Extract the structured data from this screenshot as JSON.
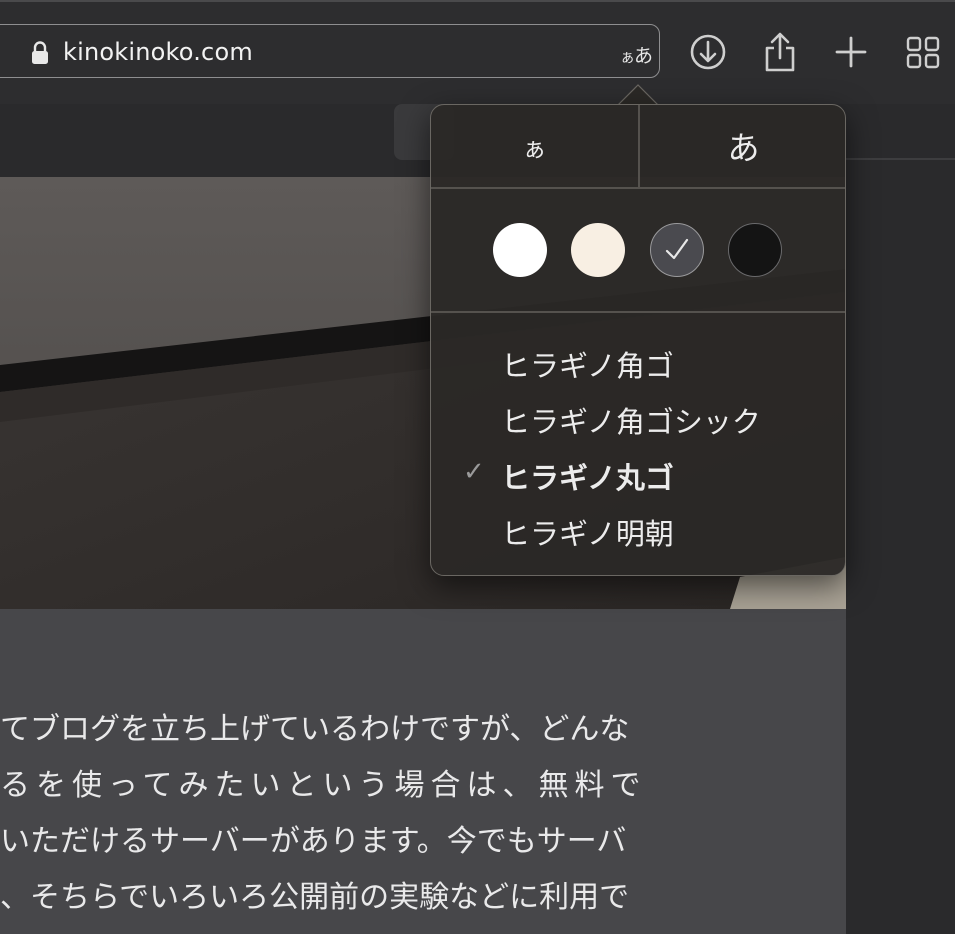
{
  "toolbar": {
    "url": "kinokinoko.com",
    "text_size_button": {
      "small": "ぁ",
      "large": "あ"
    }
  },
  "popover": {
    "size_small_label": "ぁ",
    "size_large_label": "あ",
    "themes": [
      {
        "name": "white",
        "color": "#ffffff",
        "selected": false
      },
      {
        "name": "sepia",
        "color": "#f8efe3",
        "selected": false
      },
      {
        "name": "gray",
        "color": "#4a4a4f",
        "selected": true
      },
      {
        "name": "black",
        "color": "#141414",
        "selected": false
      }
    ],
    "fonts": [
      {
        "label": "ヒラギノ角ゴ",
        "selected": false
      },
      {
        "label": "ヒラギノ角ゴシック",
        "selected": false
      },
      {
        "label": "ヒラギノ丸ゴ",
        "selected": true
      },
      {
        "label": "ヒラギノ明朝",
        "selected": false
      }
    ],
    "checkmark": "✓"
  },
  "article": {
    "lines": [
      "てブログを立ち上げているわけですが、どんな",
      "るを使ってみたいという場合は、無料で",
      "いただけるサーバーがあります。今でもサーバ",
      "、そちらでいろいろ公開前の実験などに利用で"
    ]
  }
}
